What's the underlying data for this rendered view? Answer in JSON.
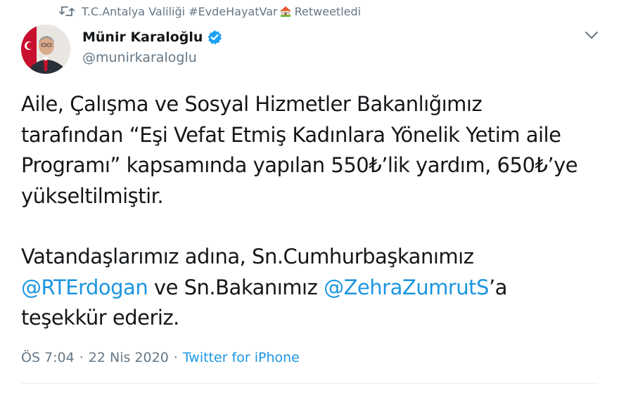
{
  "retweet": {
    "icon": "retweet-icon",
    "account": "T.C.Antalya Valiliği #EvdeHayatVar",
    "emoji": "house-with-garden-icon",
    "label": "Retweetledi"
  },
  "author": {
    "display_name": "Münir Karaloğlu",
    "handle": "@munirkaraloglu",
    "verified_icon": "verified-badge-icon",
    "avatar": "avatar"
  },
  "menu_icon": "chevron-down-icon",
  "tweet": {
    "line1": "Aile, Çalışma ve Sosyal Hizmetler Bakanlığımız",
    "line2": "tarafından “Eşi Vefat Etmiş Kadınlara Yönelik Yetim aile",
    "line3": "Programı” kapsamında yapılan 550₺’lik yardım, 650₺’ye",
    "line4": "yükseltilmiştir.",
    "line5": "Vatandaşlarımız adına, Sn.Cumhurbaşkanımız",
    "mention1": "@RTErdogan",
    "line6_mid": " ve Sn.Bakanımız ",
    "mention2": "@ZehraZumrutS",
    "line6_end": "’a",
    "line7": "teşekkür ederiz."
  },
  "meta": {
    "time": "ÖS 7:04",
    "separator1": "·",
    "date": "22 Nis 2020",
    "separator2": "·",
    "source": "Twitter for iPhone"
  },
  "colors": {
    "link": "#1b95e0",
    "muted": "#657786",
    "text": "#14171a",
    "verified": "#1da1f2"
  }
}
